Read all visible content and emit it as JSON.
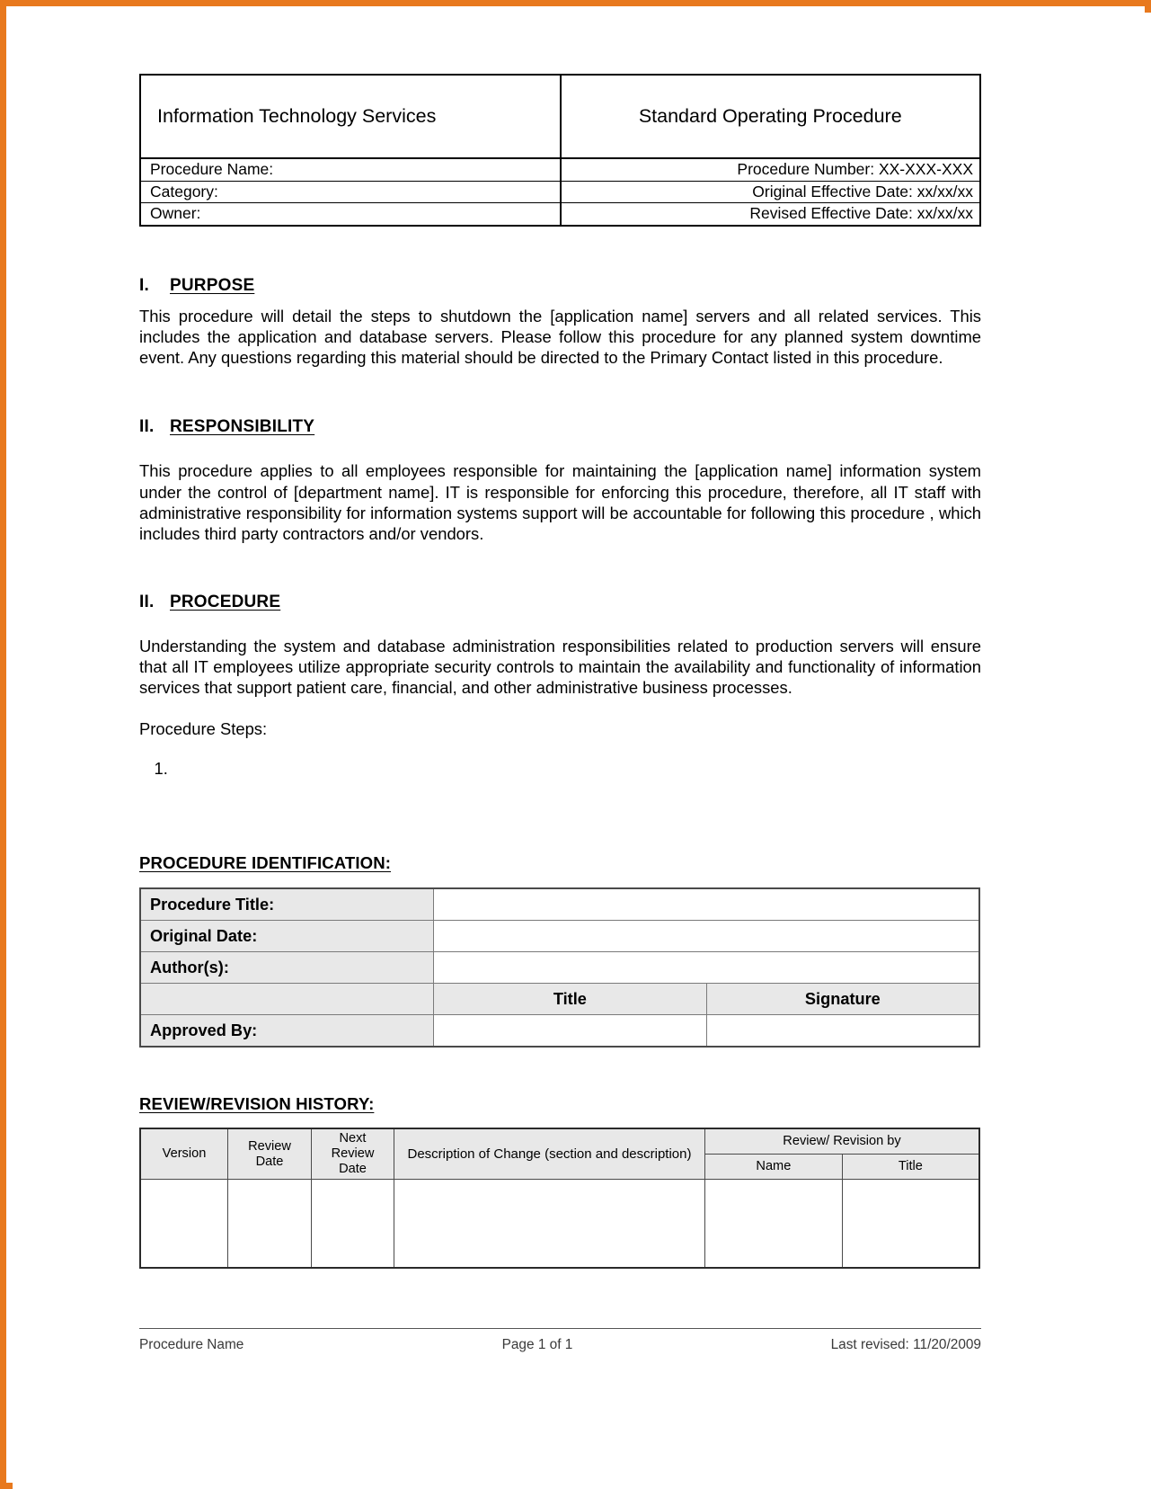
{
  "document": {
    "header": {
      "department": "Information Technology Services",
      "doc_type": "Standard Operating Procedure",
      "fields": [
        {
          "left_label": "Procedure Name:",
          "right_label": "Procedure Number:  XX-XXX-XXX"
        },
        {
          "left_label": "Category:",
          "right_label": "Original Effective Date: xx/xx/xx"
        },
        {
          "left_label": "Owner:",
          "right_label": "Revised Effective Date:  xx/xx/xx"
        }
      ]
    },
    "sections": [
      {
        "numeral": "I.",
        "title": "PURPOSE",
        "body": "This procedure will detail the steps to shutdown the [application name] servers and all related services. This includes the application and database servers. Please follow this procedure for any planned system downtime event.  Any questions regarding this material should be directed to the Primary Contact listed in this procedure."
      },
      {
        "numeral": "II.",
        "title": "RESPONSIBILITY",
        "body": "This procedure applies to all employees responsible for maintaining the [application name] information system under the control of [department name].  IT is responsible for enforcing this procedure, therefore, all IT staff with administrative responsibility for information systems support will be accountable for following this procedure , which includes third party contractors and/or vendors."
      },
      {
        "numeral": "II.",
        "title": "PROCEDURE",
        "body": "Understanding the system and database administration responsibilities related to production servers will ensure that all IT employees utilize appropriate security controls to maintain the availability and functionality of information services that support patient care, financial, and other administrative business processes.",
        "steps_label": "Procedure Steps:",
        "steps": [
          ""
        ]
      }
    ],
    "identification": {
      "heading": "PROCEDURE IDENTIFICATION:",
      "rows": [
        {
          "label": "Procedure Title:",
          "value": ""
        },
        {
          "label": "Original Date:",
          "value": ""
        },
        {
          "label": "Author(s):",
          "value": ""
        }
      ],
      "column_headers": {
        "blank": "",
        "title": "Title",
        "signature": "Signature"
      },
      "approval_row": {
        "label": "Approved By:",
        "title": "",
        "signature": ""
      }
    },
    "revision_history": {
      "heading": "REVIEW/REVISION HISTORY:",
      "columns": {
        "version": "Version",
        "review_date": "Review\nDate",
        "review_date_line1": "Review",
        "review_date_line2": "Date",
        "next_review_line1": "Next",
        "next_review_line2": "Review",
        "next_review_line3": "Date",
        "description": "Description of Change (section and description)",
        "group": "Review/ Revision by",
        "name": "Name",
        "title": "Title"
      },
      "rows": [
        {
          "version": "",
          "review_date": "",
          "next_review_date": "",
          "description": "",
          "name": "",
          "title": ""
        }
      ]
    },
    "footer": {
      "left": "Procedure Name",
      "center": "Page 1 of 1",
      "right": "Last revised:  11/20/2009"
    }
  },
  "colors": {
    "frame": "#e8791e",
    "table_fill": "#e8e8e8",
    "rule": "#4a4a4a"
  }
}
